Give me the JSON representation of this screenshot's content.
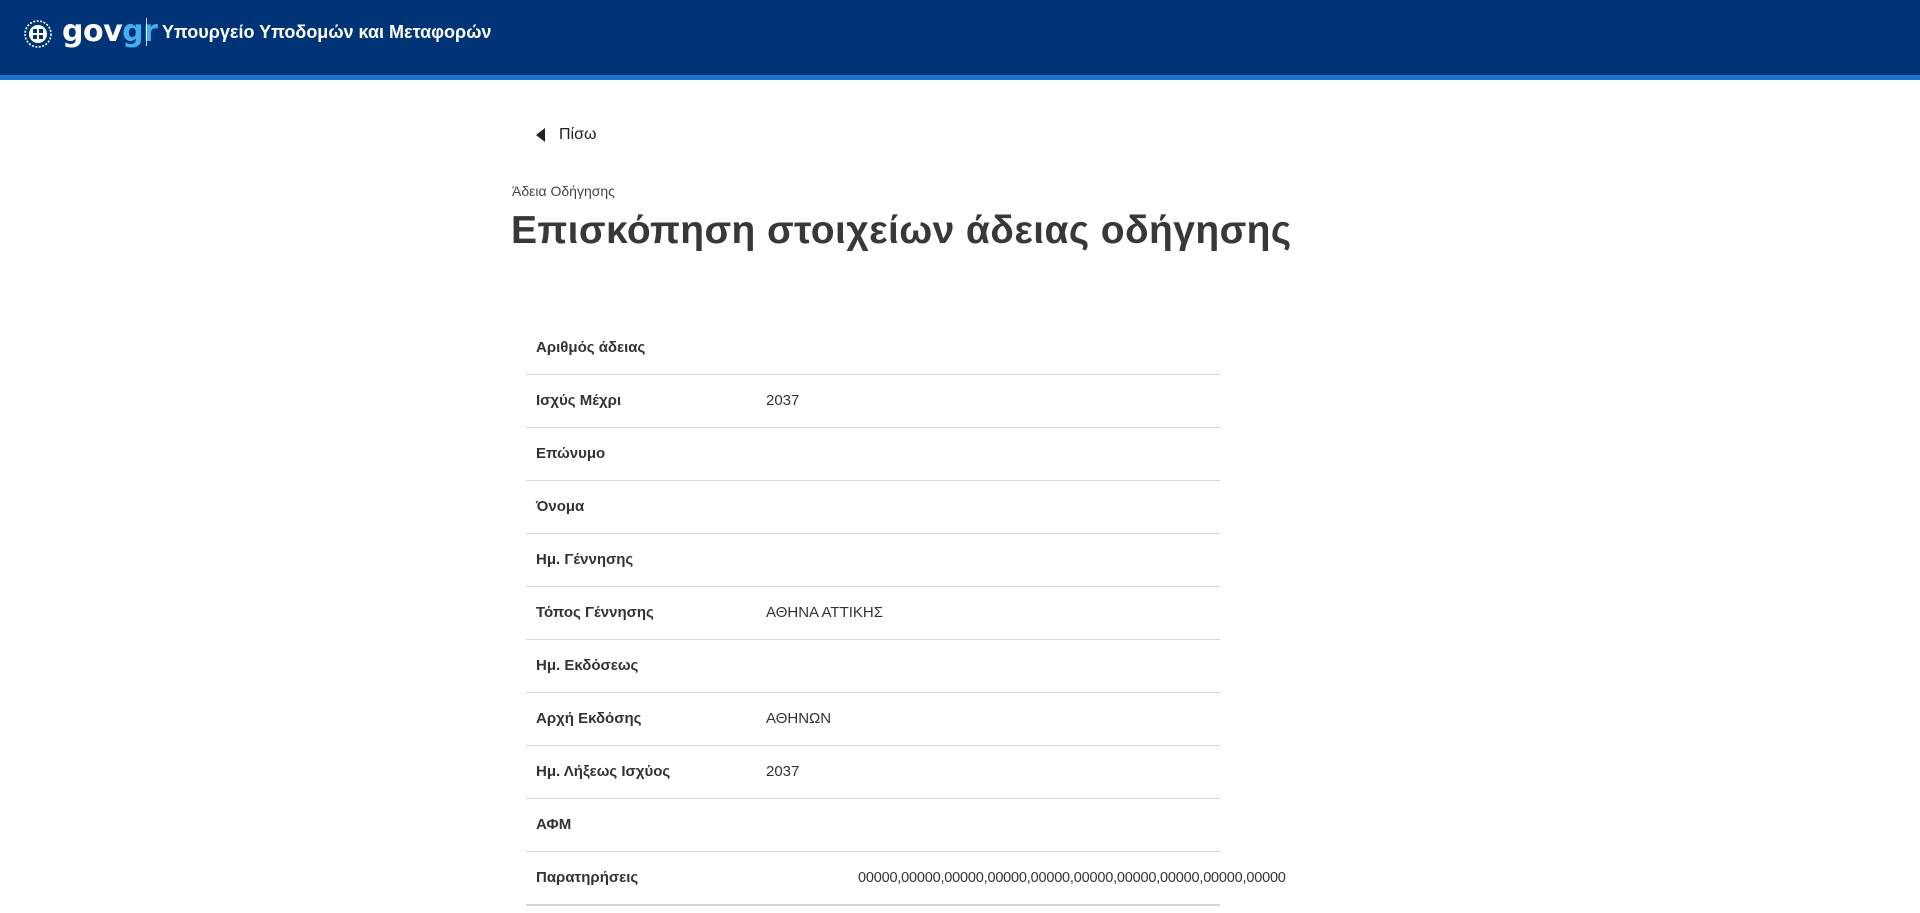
{
  "header": {
    "logo_gov": "gov",
    "logo_gr": "gr",
    "ministry": "Υπουργείο Υποδομών και Μεταφορών"
  },
  "nav": {
    "back_label": "Πίσω"
  },
  "page": {
    "caption": "Άδεια Οδήγησης",
    "title": "Επισκόπηση στοιχείων άδειας οδήγησης"
  },
  "details": [
    {
      "label": "Αριθμός άδειας",
      "value": ""
    },
    {
      "label": "Ισχύς Μέχρι",
      "value": "2037"
    },
    {
      "label": "Επώνυμο",
      "value": ""
    },
    {
      "label": "Όνομα",
      "value": ""
    },
    {
      "label": "Ημ. Γέννησης",
      "value": ""
    },
    {
      "label": "Τόπος Γέννησης",
      "value": "ΑΘΗΝΑ ΑΤΤΙΚΗΣ"
    },
    {
      "label": "Ημ. Εκδόσεως",
      "value": ""
    },
    {
      "label": "Αρχή Εκδόσης",
      "value": "ΑΘΗΝΩΝ"
    },
    {
      "label": "Ημ. Λήξεως Ισχύος",
      "value": "2037"
    },
    {
      "label": "ΑΦΜ",
      "value": ""
    },
    {
      "label": "Παρατηρήσεις",
      "value": "00000,00000,00000,00000,00000,00000,00000,00000,00000,00000"
    }
  ],
  "colors": {
    "header_bg": "#003476",
    "header_accent": "#1f73d0",
    "logo_gr": "#44aef2"
  }
}
